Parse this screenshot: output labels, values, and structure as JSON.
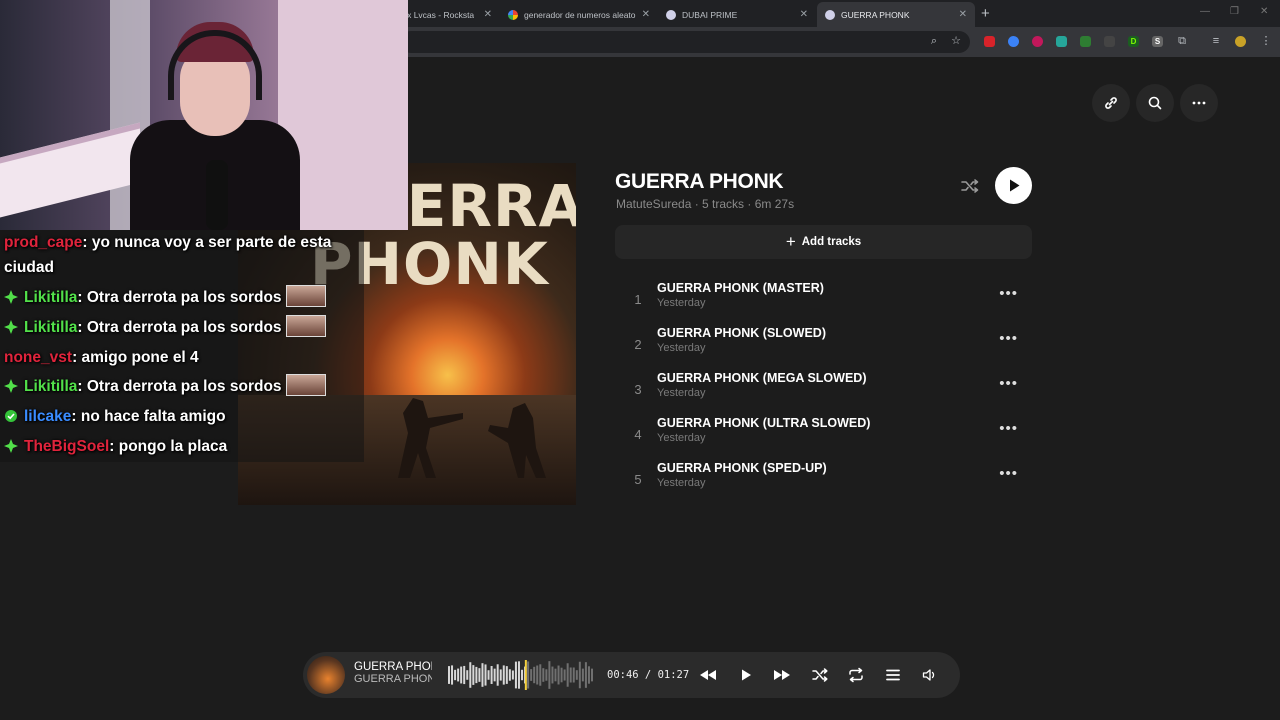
{
  "browser": {
    "tabs": [
      {
        "label": "tt x Lvcas - Rocksta",
        "active": false,
        "icon": "music-icon"
      },
      {
        "label": "generador de numeros aleatori",
        "active": false,
        "icon": "google-icon"
      },
      {
        "label": "DUBAI PRIME",
        "active": false,
        "icon": "site-icon"
      },
      {
        "label": "GUERRA PHONK",
        "active": true,
        "icon": "site-icon"
      }
    ]
  },
  "playlist": {
    "title": "GUERRA PHONK",
    "meta": "MatuteSureda · 5 tracks · 6m 27s",
    "add_tracks_label": "Add tracks",
    "cover_line1": "GUERRA",
    "cover_line2": "PHONK",
    "tracks": [
      {
        "num": "1",
        "name": "GUERRA PHONK (MASTER)",
        "date": "Yesterday"
      },
      {
        "num": "2",
        "name": "GUERRA PHONK (SLOWED)",
        "date": "Yesterday"
      },
      {
        "num": "3",
        "name": "GUERRA PHONK (MEGA SLOWED)",
        "date": "Yesterday"
      },
      {
        "num": "4",
        "name": "GUERRA PHONK (ULTRA SLOWED)",
        "date": "Yesterday"
      },
      {
        "num": "5",
        "name": "GUERRA PHONK (SPED-UP)",
        "date": "Yesterday"
      }
    ],
    "more_glyph": "•••"
  },
  "chat": {
    "messages": [
      {
        "user": "prod_cape",
        "user_color": "#e0243c",
        "text": ": yo nunca voy a ser parte de esta",
        "text2": "ciudad",
        "badge": "none"
      },
      {
        "user": "Likitilla",
        "user_color": "#52e04a",
        "text": ": Otra derrota pa los sordos",
        "badge": "green-diamond-icon",
        "emote": true
      },
      {
        "user": "Likitilla",
        "user_color": "#52e04a",
        "text": ": Otra derrota pa los sordos",
        "badge": "green-diamond-icon",
        "emote": true
      },
      {
        "user": "none_vst",
        "user_color": "#e0243c",
        "text": ": amigo pone el 4",
        "badge": "none"
      },
      {
        "user": "Likitilla",
        "user_color": "#52e04a",
        "text": ": Otra derrota pa los sordos",
        "badge": "green-diamond-icon",
        "emote": true
      },
      {
        "user": "lilcake",
        "user_color": "#3a8cff",
        "text": ": no hace falta amigo",
        "badge": "verified-icon"
      },
      {
        "user": "TheBigSoel",
        "user_color": "#e0243c",
        "text": ": pongo la placa",
        "badge": "green-diamond-icon"
      }
    ]
  },
  "player": {
    "now_playing_title": "GUERRA PHONK",
    "now_playing_artist": "GUERRA PHONK",
    "time": "00:46 / 01:27",
    "progress": 0.53,
    "accent": "#f4d03f"
  }
}
